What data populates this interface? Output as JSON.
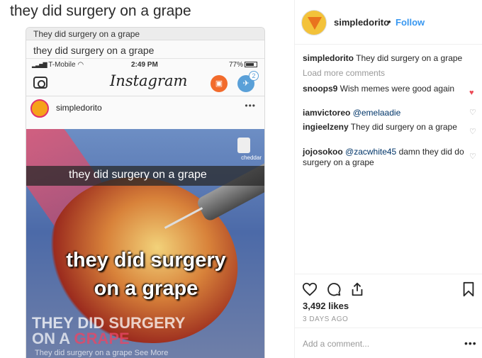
{
  "meme_title": "they did surgery on a grape",
  "phone": {
    "browser_title": "They did surgery on a grape",
    "url_title": "they did surgery on a grape",
    "status": {
      "carrier": "T-Mobile",
      "time": "2:49 PM",
      "battery": "77%"
    },
    "app_name": "Instagram",
    "badge_count": "2",
    "post_user": "simpledorito",
    "more": "•••",
    "image": {
      "watermark": "cheddar",
      "snap_caption": "they did surgery on a grape",
      "caption_line1": "they did surgery",
      "caption_line2": "on a grape",
      "overlay_line1": "THEY DID SURGERY",
      "overlay_line2_a": "ON A ",
      "overlay_line2_b": "GRAPE",
      "bottom_text": "They did surgery on a grape See More"
    }
  },
  "post": {
    "username": "simpledorito",
    "dot": "•",
    "follow_label": "Follow",
    "caption": {
      "user": "simpledorito",
      "text": " They did surgery on a grape"
    },
    "load_more": "Load more comments",
    "comments": [
      {
        "user": "snoops9",
        "text": " Wish memes were good again",
        "mention": ""
      },
      {
        "user": "iamvictoreo",
        "text": "",
        "mention": " @emelaadie"
      },
      {
        "user": "ingieelzeny",
        "text": " They did surgery on a grape",
        "mention": ""
      },
      {
        "user": "jojosokoo",
        "text": " damn they did do surgery on a grape",
        "mention": " @zacwhite45"
      }
    ],
    "likes": "3,492 likes",
    "time_ago": "3 DAYS AGO",
    "add_comment_placeholder": "Add a comment...",
    "more": "•••"
  },
  "colors": {
    "follow": "#3897f0",
    "heart_liked": "#ed4956",
    "muted": "#999999"
  },
  "icons": [
    "heart-icon",
    "comment-icon",
    "share-icon",
    "bookmark-icon",
    "camera-icon"
  ]
}
